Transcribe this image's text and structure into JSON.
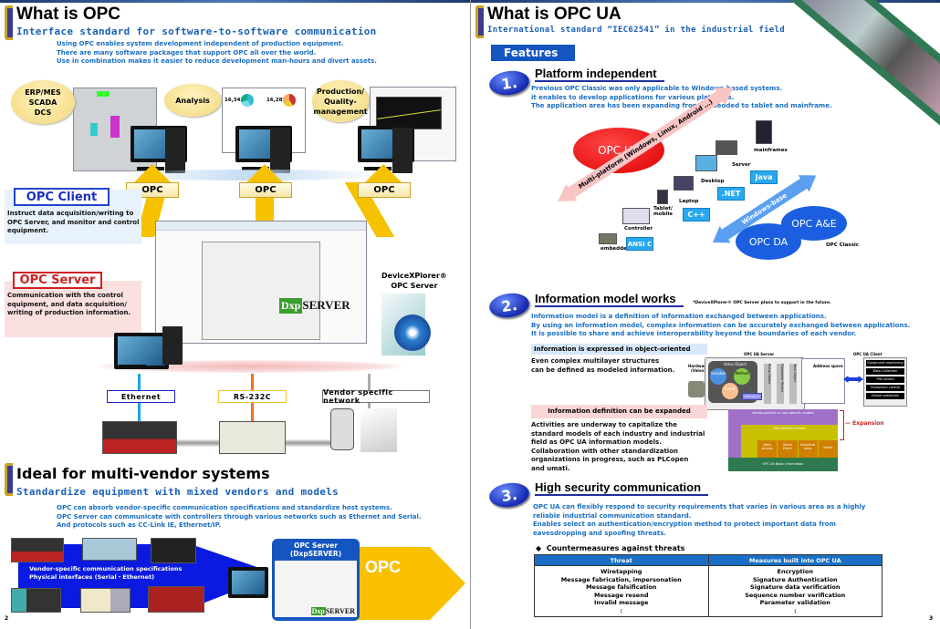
{
  "left_page": {
    "title": "What is OPC",
    "subtitle": "Interface standard for software-to-software communication",
    "intro": [
      "Using OPC enables system development independent of production equipment.",
      "There are many software packages that support OPC all over the world.",
      "Use in combination makes it easier to reduce development man-hours and divert assets."
    ],
    "client_apps": [
      {
        "label": "ERP/MES\nSCADA\nDCS"
      },
      {
        "label": "Analysis"
      },
      {
        "label": "Production/\nQuality-\nmanagement"
      }
    ],
    "analysis_values": [
      "16,343",
      "16,287"
    ],
    "opc_arrow_label": "OPC",
    "opc_client": {
      "label": "OPC Client",
      "description": "Instruct data acquisition/writing to OPC Server, and monitor and control equipment."
    },
    "opc_server": {
      "label": "OPC Server",
      "description": "Communication with the control equipment, and data acquisition/ writing of production information."
    },
    "product": {
      "name": "DeviceXPlorer®",
      "name2": "OPC Server",
      "logo_a": "Dxp",
      "logo_b": "SERVER"
    },
    "networks": [
      {
        "label": "Ethernet",
        "color": "#2222cc",
        "arrow": "#1aa6e8"
      },
      {
        "label": "RS-232C",
        "color": "#f0c030",
        "arrow": "#f07020"
      },
      {
        "label": "Vendor specific network",
        "color": "#777777",
        "arrow": "#aaaaaa"
      }
    ],
    "section2": {
      "title": "Ideal for multi-vendor systems",
      "subtitle": "Standardize equipment with mixed vendors and models",
      "intro": [
        "OPC can absorb vendor-specific communication specifications and standardize host systems.",
        "OPC Server can communicate with controllers through various networks such as Ethernet and Serial.",
        "And protocols such as CC-Link IE, Ethernet/IP."
      ],
      "band_text": [
        "Vendor-specific communication specifications",
        "Physical interfaces (Serial・Ethernet)"
      ],
      "server_box": [
        "OPC Server",
        "(DxpSERVER)"
      ],
      "opc_label": "OPC"
    },
    "page_number": "2"
  },
  "right_page": {
    "title": "What is OPC UA",
    "subtitle": "International standard “IEC62541” in the industrial field",
    "features_label": "Features",
    "features": [
      {
        "number": "1.",
        "title": "Platform independent",
        "text": [
          "Previous OPC Classic was only applicable to Windows-based systems.",
          "it enables to develop applications for various platforms.",
          "The application area has been expanding from embedded to tablet and mainframe."
        ]
      },
      {
        "number": "2.",
        "title": "Information model works",
        "note": "*DeviceXPlorer® OPC Server plans to support in the future.",
        "text": [
          "Information model is a definition of information exchanged between applications.",
          "By using an information model, complex information can be accurately exchanged between applications.",
          "It is possible to share and achieve interoperability beyond the boundaries of each vendor."
        ]
      },
      {
        "number": "3.",
        "title": "High security communication",
        "text": [
          "OPC UA can flexibly respond to security requirements that varies in various area as a highly",
          "reliable industrial communication standard.",
          "Enables select an authentication/encryption method to protect important data from",
          "eavesdropping and spoofing threats."
        ]
      }
    ],
    "platform_diagram": {
      "opc_ua": "OPC UA",
      "multi_platform": "Multi-platform (Windows, Linux, Android …)",
      "windows_base": "Windows-base",
      "opc_ae": "OPC A&E",
      "opc_da": "OPC DA",
      "opc_classic": "OPC Classic",
      "devices": [
        "mainframes",
        "Server",
        "Desktop",
        "Laptop",
        "Tablet/\nmobile",
        "Controller",
        "embedded"
      ],
      "languages": [
        "Java",
        ".NET",
        "C++",
        "ANSI C"
      ]
    },
    "object_oriented": {
      "label": "Information is expressed in object-oriented",
      "text": [
        "Even complex multilayer structures",
        "can  be defined as modeled information."
      ],
      "server_label": "OPC UA Server",
      "client_label": "OPC UA Client",
      "hardware": "Hardware\n(Valve)",
      "valve_object": "Valve Object",
      "circles": [
        "Variable",
        "Method",
        "Event"
      ],
      "reference": "reference",
      "objects": [
        "Pump Object",
        "Flowmeter Object",
        "Tank Object"
      ],
      "address_space": "Address space",
      "client_items": [
        "Equipment monitoring",
        "Data Collection",
        "PID control",
        "Production control",
        "Failure prediction"
      ]
    },
    "expansion": {
      "label": "Information definition can be expanded",
      "text": [
        "Activities are underway to capitalize the",
        "standard models of each industry and industrial",
        "field as OPC UA information models.",
        "Collaboration with other standardization",
        "organizations in progress, such as PLCopen",
        "and umati."
      ],
      "layers": {
        "vendor": "Vendor-specific or user-specific models",
        "standard": "Standardized model",
        "blocks": [
          "Data\nAccess",
          "Alarm\nEvent",
          "Historical\ndata",
          "Batch"
        ],
        "basic": "OPC UA Basic information"
      },
      "expansion_label": "Expansion"
    },
    "countermeasures": {
      "heading": "Countermeasures against threats",
      "columns": [
        "Threat",
        "Measures built into OPC UA"
      ],
      "threats": [
        "Wiretapping",
        "Message fabrication, impersonation",
        "Message falsification",
        "Message resend",
        "Invalid message",
        ":"
      ],
      "measures": [
        "Encryption",
        "Signature Authentication",
        "Signature data verification",
        "Sequence number verification",
        "Parameter validation",
        ":"
      ]
    },
    "page_number": "3"
  }
}
